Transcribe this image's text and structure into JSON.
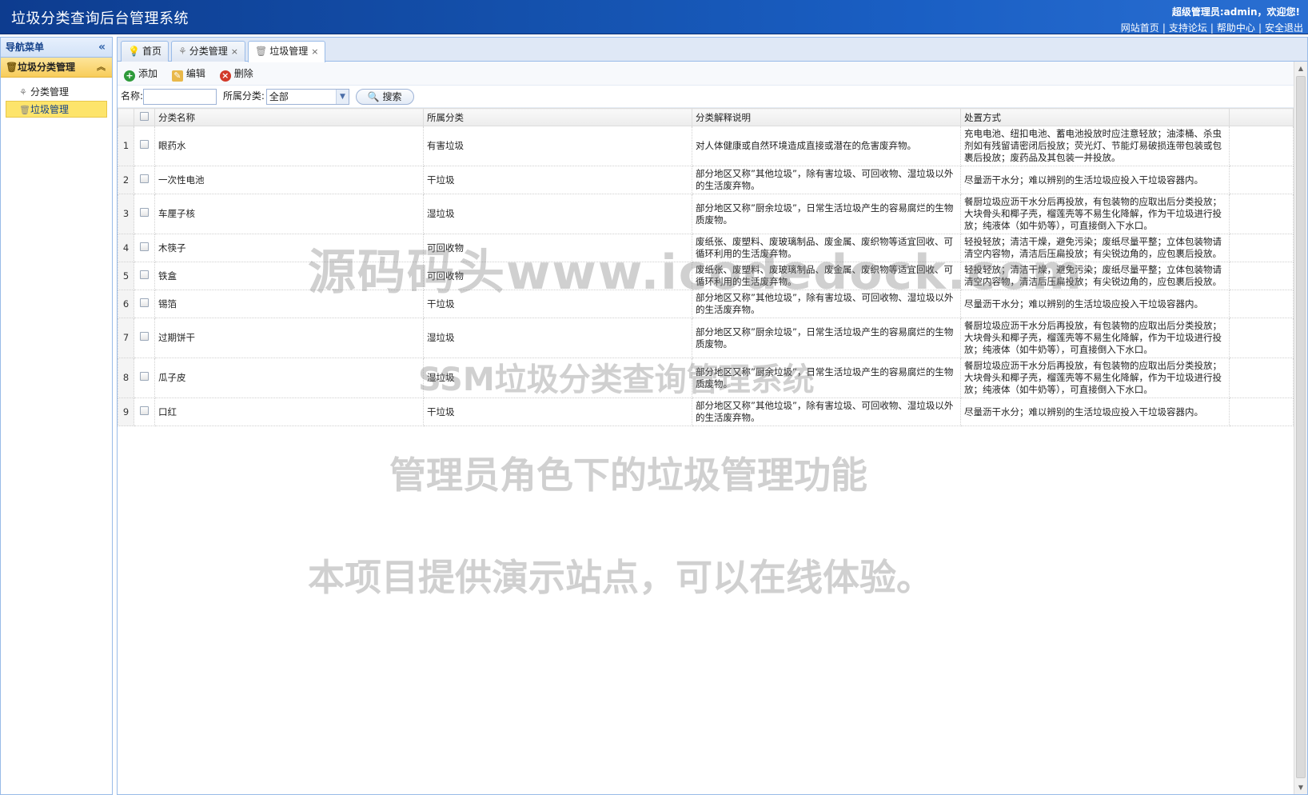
{
  "header": {
    "title": "垃圾分类查询后台管理系统",
    "greeting": "超级管理员:admin，欢迎您!",
    "links": [
      "网站首页",
      "支持论坛",
      "帮助中心",
      "安全退出"
    ],
    "bg_color": "#1553b0"
  },
  "nav": {
    "title": "导航菜单",
    "collapse_icon": "double-chevron-left",
    "group": {
      "label": "垃圾分类管理",
      "icon": "trash-icon",
      "items": [
        {
          "label": "分类管理",
          "icon": "tree-icon",
          "active": false
        },
        {
          "label": "垃圾管理",
          "icon": "trash-icon",
          "active": true
        }
      ]
    }
  },
  "tabs": [
    {
      "label": "首页",
      "icon": "bulb-icon",
      "closable": false,
      "active": false
    },
    {
      "label": "分类管理",
      "icon": "tree-icon",
      "closable": true,
      "active": false
    },
    {
      "label": "垃圾管理",
      "icon": "trash-icon",
      "closable": true,
      "active": true
    }
  ],
  "toolbar": {
    "add": "添加",
    "edit": "编辑",
    "delete": "删除"
  },
  "search": {
    "name_label": "名称:",
    "name_value": "",
    "category_label": "所属分类:",
    "category_value": "全部",
    "button": "搜索"
  },
  "table": {
    "columns": [
      "分类名称",
      "所属分类",
      "分类解释说明",
      "处置方式"
    ],
    "rows": [
      {
        "no": "1",
        "name": "眼药水",
        "category": "有害垃圾",
        "desc": "对人体健康或自然环境造成直接或潜在的危害废弃物。",
        "method": "充电电池、纽扣电池、蓄电池投放时应注意轻放；油漆桶、杀虫剂如有残留请密闭后投放；荧光灯、节能灯易破损连带包装或包裹后投放；废药品及其包装一并投放。"
      },
      {
        "no": "2",
        "name": "一次性电池",
        "category": "干垃圾",
        "desc": "部分地区又称”其他垃圾”，除有害垃圾、可回收物、湿垃圾以外的生活废弃物。",
        "method": "尽量沥干水分；难以辨别的生活垃圾应投入干垃圾容器内。"
      },
      {
        "no": "3",
        "name": "车厘子核",
        "category": "湿垃圾",
        "desc": "部分地区又称”厨余垃圾”，日常生活垃圾产生的容易腐烂的生物质废物。",
        "method": "餐厨垃圾应沥干水分后再投放，有包装物的应取出后分类投放；大块骨头和椰子壳，榴莲壳等不易生化降解，作为干垃圾进行投放；纯液体（如牛奶等），可直接倒入下水口。"
      },
      {
        "no": "4",
        "name": "木筷子",
        "category": "可回收物",
        "desc": "废纸张、废塑料、废玻璃制品、废金属、废织物等适宜回收、可循环利用的生活废弃物。",
        "method": "轻投轻放；清洁干燥，避免污染；废纸尽量平整；立体包装物请清空内容物，清洁后压扁投放；有尖锐边角的，应包裹后投放。"
      },
      {
        "no": "5",
        "name": "铁盒",
        "category": "可回收物",
        "desc": "废纸张、废塑料、废玻璃制品、废金属、废织物等适宜回收、可循环利用的生活废弃物。",
        "method": "轻投轻放；清洁干燥，避免污染；废纸尽量平整；立体包装物请清空内容物，清洁后压扁投放；有尖锐边角的，应包裹后投放。"
      },
      {
        "no": "6",
        "name": "锡箔",
        "category": "干垃圾",
        "desc": "部分地区又称”其他垃圾”，除有害垃圾、可回收物、湿垃圾以外的生活废弃物。",
        "method": "尽量沥干水分；难以辨别的生活垃圾应投入干垃圾容器内。"
      },
      {
        "no": "7",
        "name": "过期饼干",
        "category": "湿垃圾",
        "desc": "部分地区又称”厨余垃圾”，日常生活垃圾产生的容易腐烂的生物质废物。",
        "method": "餐厨垃圾应沥干水分后再投放，有包装物的应取出后分类投放；大块骨头和椰子壳，榴莲壳等不易生化降解，作为干垃圾进行投放；纯液体（如牛奶等），可直接倒入下水口。"
      },
      {
        "no": "8",
        "name": "瓜子皮",
        "category": "湿垃圾",
        "desc": "部分地区又称”厨余垃圾”，日常生活垃圾产生的容易腐烂的生物质废物。",
        "method": "餐厨垃圾应沥干水分后再投放，有包装物的应取出后分类投放；大块骨头和椰子壳，榴莲壳等不易生化降解，作为干垃圾进行投放；纯液体（如牛奶等），可直接倒入下水口。"
      },
      {
        "no": "9",
        "name": "口红",
        "category": "干垃圾",
        "desc": "部分地区又称”其他垃圾”，除有害垃圾、可回收物、湿垃圾以外的生活废弃物。",
        "method": "尽量沥干水分；难以辨别的生活垃圾应投入干垃圾容器内。"
      }
    ]
  },
  "watermarks": [
    "源码码头www.icodedock.com",
    "SSM垃圾分类查询管理系统",
    "管理员角色下的垃圾管理功能",
    "本项目提供演示站点，可以在线体验。"
  ]
}
